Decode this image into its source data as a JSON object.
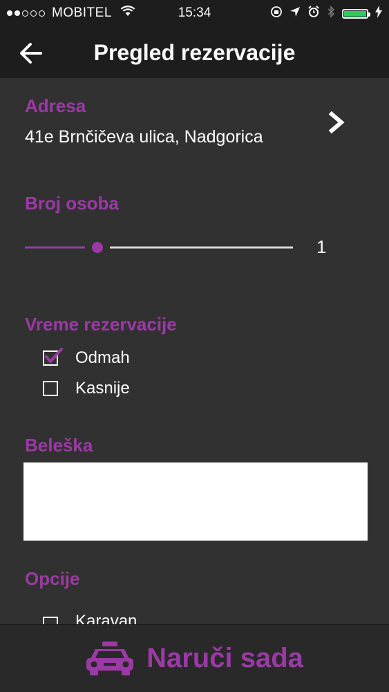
{
  "status_bar": {
    "carrier": "MOBITEL",
    "time": "15:34",
    "battery_color": "#34c759"
  },
  "header": {
    "title": "Pregled rezervacije",
    "back_icon": "arrow-left-icon"
  },
  "address": {
    "label": "Adresa",
    "value": "41e Brnčičeva ulica, Nadgorica",
    "chevron_icon": "chevron-right-icon"
  },
  "persons": {
    "label": "Broj osoba",
    "value": "1",
    "slider_fraction": 0.27
  },
  "reservation_time": {
    "label": "Vreme rezervacije",
    "options": [
      {
        "label": "Odmah",
        "checked": true
      },
      {
        "label": "Kasnije",
        "checked": false
      }
    ]
  },
  "note": {
    "label": "Beleška",
    "value": ""
  },
  "options": {
    "label": "Opcije",
    "items": [
      {
        "label": "Karavan",
        "checked": false
      }
    ]
  },
  "order_button": {
    "label": "Naruči sada",
    "icon": "taxi-icon"
  },
  "colors": {
    "accent": "#9b3aa5",
    "background": "#323132",
    "bar": "#1d1d1d"
  }
}
